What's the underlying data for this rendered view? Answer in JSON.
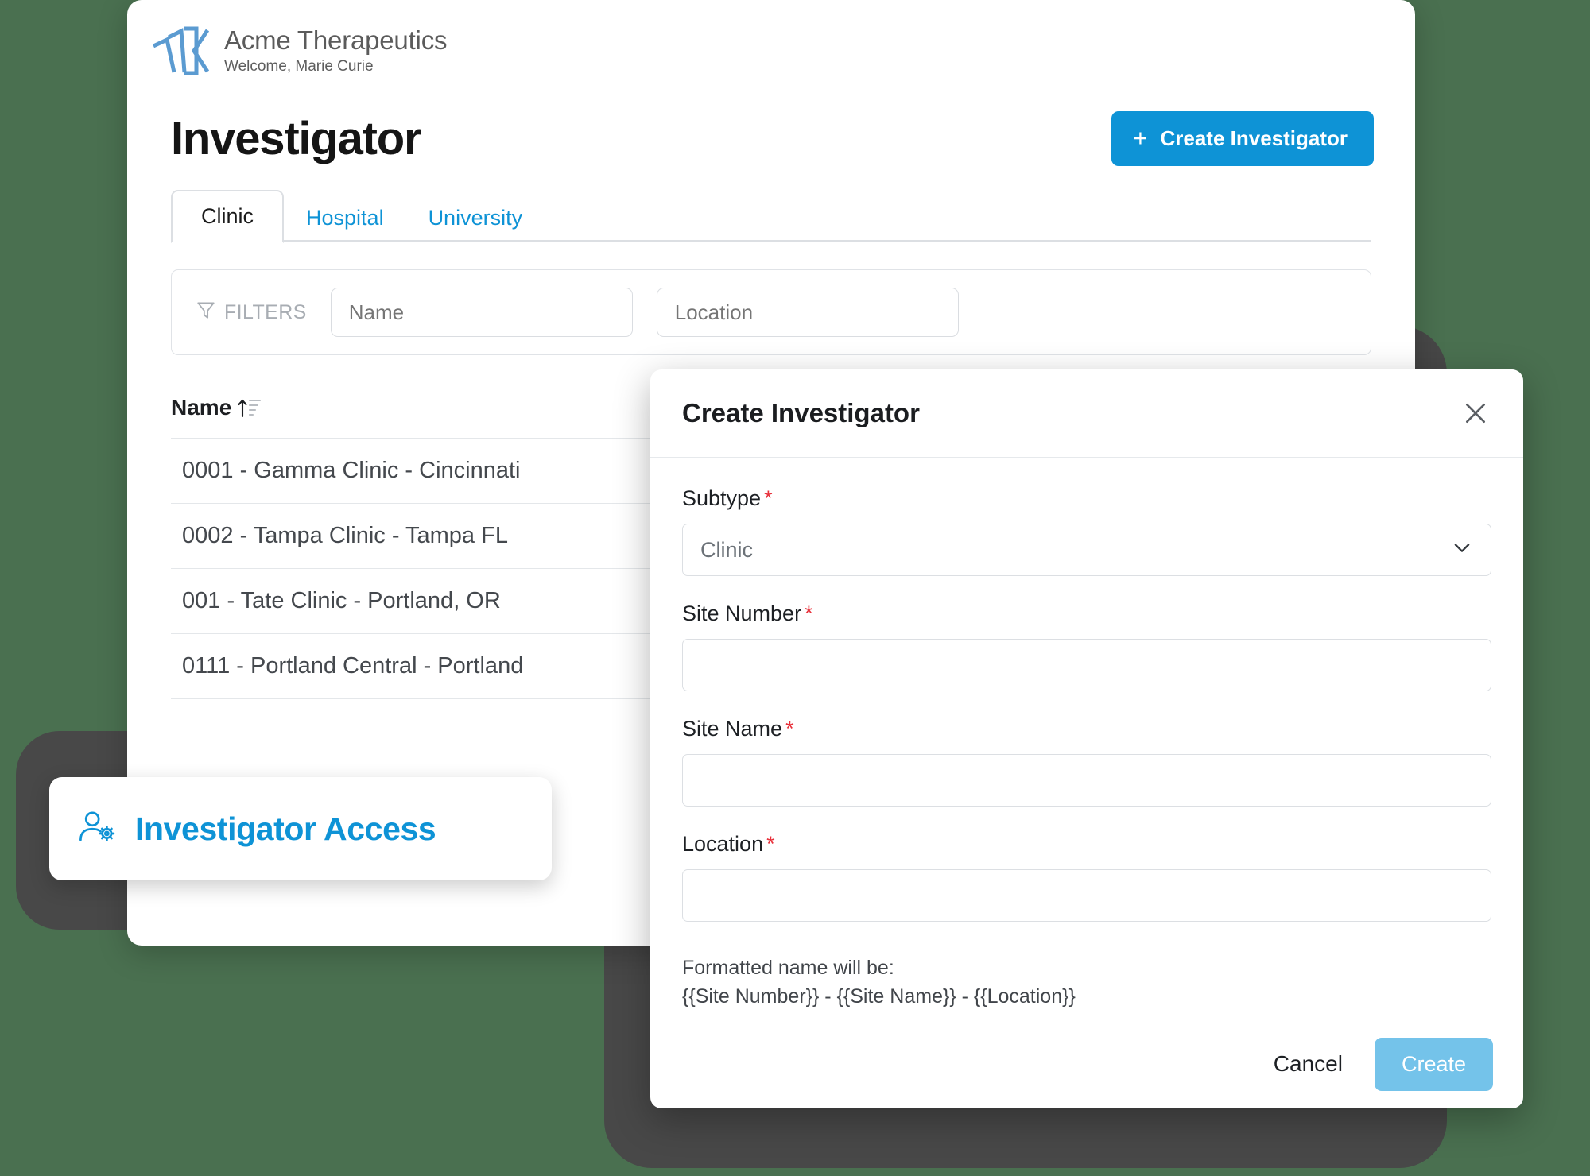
{
  "theme": {
    "page_background": "#4a7050",
    "backdrop_shape": "#484848",
    "accent_blue": "#0e93d6",
    "accent_blue_muted": "#74c3ea",
    "required_red": "#e8313b",
    "logo_blue": "#5b9bd1"
  },
  "app": {
    "brand_name": "Acme Therapeutics",
    "welcome": "Welcome, Marie Curie",
    "logo_icon": "stacked-chevrons-logo"
  },
  "page": {
    "title": "Investigator",
    "create_button": {
      "label": "Create Investigator",
      "icon": "plus-icon"
    }
  },
  "tabs": [
    {
      "label": "Clinic",
      "active": true
    },
    {
      "label": "Hospital",
      "active": false
    },
    {
      "label": "University",
      "active": false
    }
  ],
  "filters": {
    "icon": "funnel-icon",
    "label": "FILTERS",
    "name_placeholder": "Name",
    "name_value": "",
    "location_placeholder": "Location",
    "location_value": ""
  },
  "table": {
    "column_header": "Name",
    "sort_icon": "sort-ascending-icon",
    "rows": [
      "0001 - Gamma Clinic - Cincinnati",
      "0002 - Tampa Clinic - Tampa FL",
      "001 - Tate Clinic - Portland, OR",
      "0111 - Portland Central - Portland"
    ]
  },
  "badge": {
    "icon": "user-gear-icon",
    "label": "Investigator Access"
  },
  "modal": {
    "title": "Create Investigator",
    "close_icon": "close-icon",
    "fields": [
      {
        "label": "Subtype",
        "required_marker": "*",
        "type": "select",
        "value": "Clinic",
        "chevron_icon": "chevron-down-icon"
      },
      {
        "label": "Site Number",
        "required_marker": "*",
        "type": "text",
        "value": "",
        "placeholder": ""
      },
      {
        "label": "Site Name",
        "required_marker": "*",
        "type": "text",
        "value": "",
        "placeholder": ""
      },
      {
        "label": "Location",
        "required_marker": "*",
        "type": "text",
        "value": "",
        "placeholder": ""
      }
    ],
    "hint_title": "Formatted name will be:",
    "hint_pattern": "{{Site Number}} - {{Site Name}} - {{Location}}",
    "cancel_label": "Cancel",
    "create_label": "Create"
  }
}
